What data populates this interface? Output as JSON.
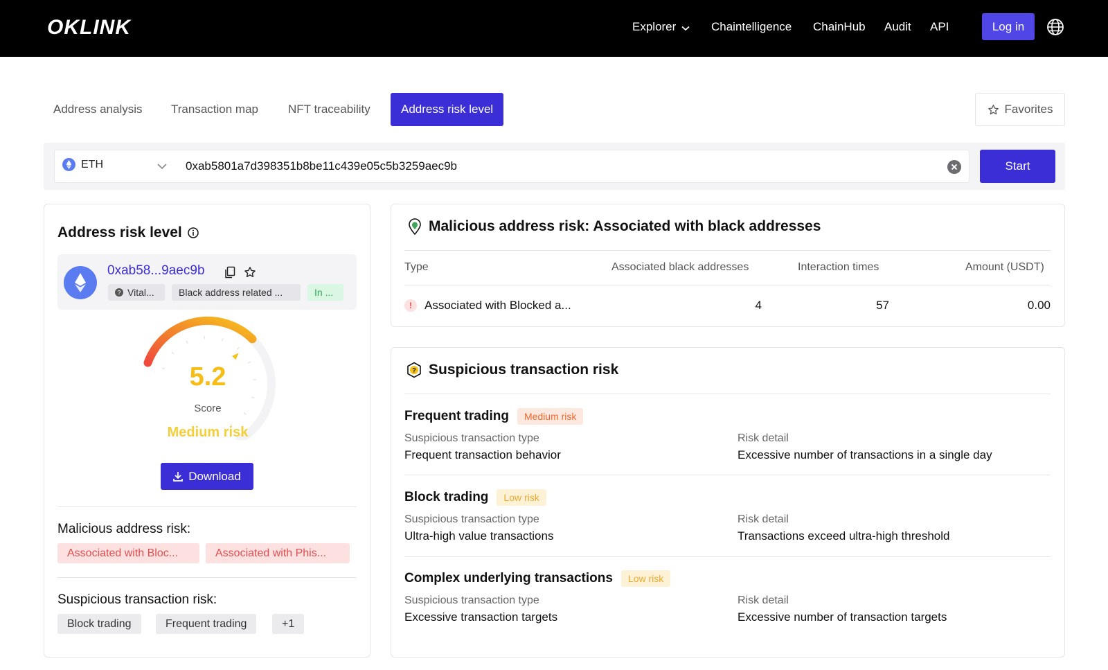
{
  "header": {
    "logo": "OKLINK",
    "nav": {
      "explorer": "Explorer",
      "chaintelligence": "Chaintelligence",
      "chainhub": "ChainHub",
      "audit": "Audit",
      "api": "API"
    },
    "login": "Log in"
  },
  "tabs": {
    "address_analysis": "Address analysis",
    "transaction_map": "Transaction map",
    "nft_traceability": "NFT traceability",
    "address_risk_level": "Address risk level",
    "favorites": "Favorites"
  },
  "search": {
    "chain": "ETH",
    "address": "0xab5801a7d398351b8be11c439e05c5b3259aec9b",
    "start": "Start"
  },
  "risk_panel": {
    "title": "Address risk level",
    "short_address": "0xab58...9aec9b",
    "tags": [
      "Vital...",
      "Black address related ...",
      "In ..."
    ],
    "score": "5.2",
    "score_label": "Score",
    "score_fraction": 0.52,
    "risk_label": "Medium risk",
    "download": "Download",
    "malicious_heading": "Malicious address risk:",
    "malicious_tags": [
      "Associated with Bloc...",
      "Associated with Phis..."
    ],
    "suspicious_heading": "Suspicious transaction risk:",
    "suspicious_tags": [
      "Block trading",
      "Frequent trading",
      "+1"
    ]
  },
  "malicious": {
    "title": "Malicious address risk: Associated with black addresses",
    "columns": [
      "Type",
      "Associated black addresses",
      "Interaction times",
      "Amount (USDT)"
    ],
    "rows": [
      {
        "type": "Associated with Blocked a...",
        "black_addresses": "4",
        "interactions": "57",
        "amount": "0.00"
      }
    ]
  },
  "suspicious": {
    "title": "Suspicious transaction risk",
    "type_key": "Suspicious transaction type",
    "detail_key": "Risk detail",
    "items": [
      {
        "name": "Frequent trading",
        "level": "Medium risk",
        "type": "Frequent transaction behavior",
        "detail": "Excessive number of transactions in a single day"
      },
      {
        "name": "Block trading",
        "level": "Low risk",
        "type": "Ultra-high value transactions",
        "detail": "Transactions exceed ultra-high threshold"
      },
      {
        "name": "Complex underlying transactions",
        "level": "Low risk",
        "type": "Excessive transaction targets",
        "detail": "Excessive number of transaction targets"
      }
    ]
  },
  "colors": {
    "header_bg": "#000000",
    "accent": "#3b2ed6",
    "medium_risk": "#f5bd16",
    "red_tag": "#e05050",
    "green_tag": "#2fa85a"
  }
}
